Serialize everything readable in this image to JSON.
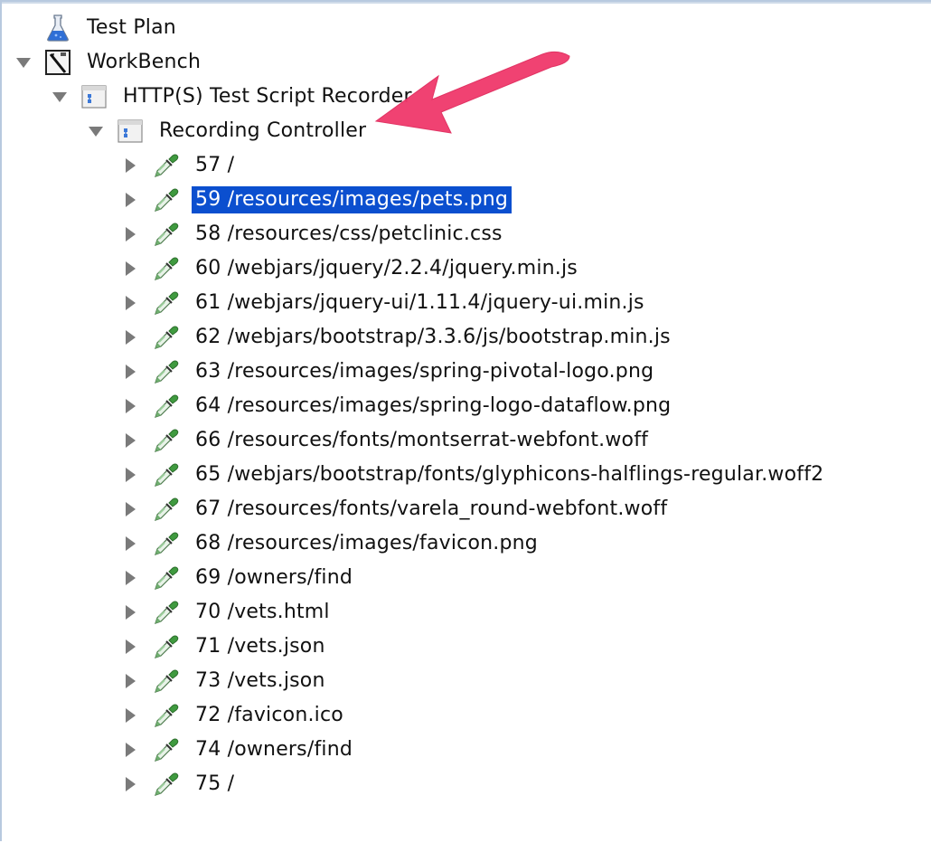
{
  "tree": {
    "root": {
      "label": "Test Plan",
      "icon": "flask-icon"
    },
    "workbench": {
      "label": "WorkBench",
      "icon": "workbench-icon",
      "expanded": true
    },
    "recorder": {
      "label": "HTTP(S) Test Script Recorder",
      "icon": "controller-icon",
      "expanded": true
    },
    "controller": {
      "label": "Recording Controller",
      "icon": "controller-icon",
      "expanded": true
    },
    "samplers": [
      {
        "label": "57 /",
        "icon": "pipette-icon",
        "selected": false
      },
      {
        "label": "59 /resources/images/pets.png",
        "icon": "pipette-icon",
        "selected": true
      },
      {
        "label": "58 /resources/css/petclinic.css",
        "icon": "pipette-icon",
        "selected": false
      },
      {
        "label": "60 /webjars/jquery/2.2.4/jquery.min.js",
        "icon": "pipette-icon",
        "selected": false
      },
      {
        "label": "61 /webjars/jquery-ui/1.11.4/jquery-ui.min.js",
        "icon": "pipette-icon",
        "selected": false
      },
      {
        "label": "62 /webjars/bootstrap/3.3.6/js/bootstrap.min.js",
        "icon": "pipette-icon",
        "selected": false
      },
      {
        "label": "63 /resources/images/spring-pivotal-logo.png",
        "icon": "pipette-icon",
        "selected": false
      },
      {
        "label": "64 /resources/images/spring-logo-dataflow.png",
        "icon": "pipette-icon",
        "selected": false
      },
      {
        "label": "66 /resources/fonts/montserrat-webfont.woff",
        "icon": "pipette-icon",
        "selected": false
      },
      {
        "label": "65 /webjars/bootstrap/fonts/glyphicons-halflings-regular.woff2",
        "icon": "pipette-icon",
        "selected": false
      },
      {
        "label": "67 /resources/fonts/varela_round-webfont.woff",
        "icon": "pipette-icon",
        "selected": false
      },
      {
        "label": "68 /resources/images/favicon.png",
        "icon": "pipette-icon",
        "selected": false
      },
      {
        "label": "69 /owners/find",
        "icon": "pipette-icon",
        "selected": false
      },
      {
        "label": "70 /vets.html",
        "icon": "pipette-icon",
        "selected": false
      },
      {
        "label": "71 /vets.json",
        "icon": "pipette-icon",
        "selected": false
      },
      {
        "label": "73 /vets.json",
        "icon": "pipette-icon",
        "selected": false
      },
      {
        "label": "72 /favicon.ico",
        "icon": "pipette-icon",
        "selected": false
      },
      {
        "label": "74 /owners/find",
        "icon": "pipette-icon",
        "selected": false
      },
      {
        "label": "75 /",
        "icon": "pipette-icon",
        "selected": false
      }
    ]
  },
  "colors": {
    "selection": "#0b4fcf",
    "annotation_arrow": "#f0386b"
  },
  "annotation": {
    "icon": "pointer-arrow"
  }
}
